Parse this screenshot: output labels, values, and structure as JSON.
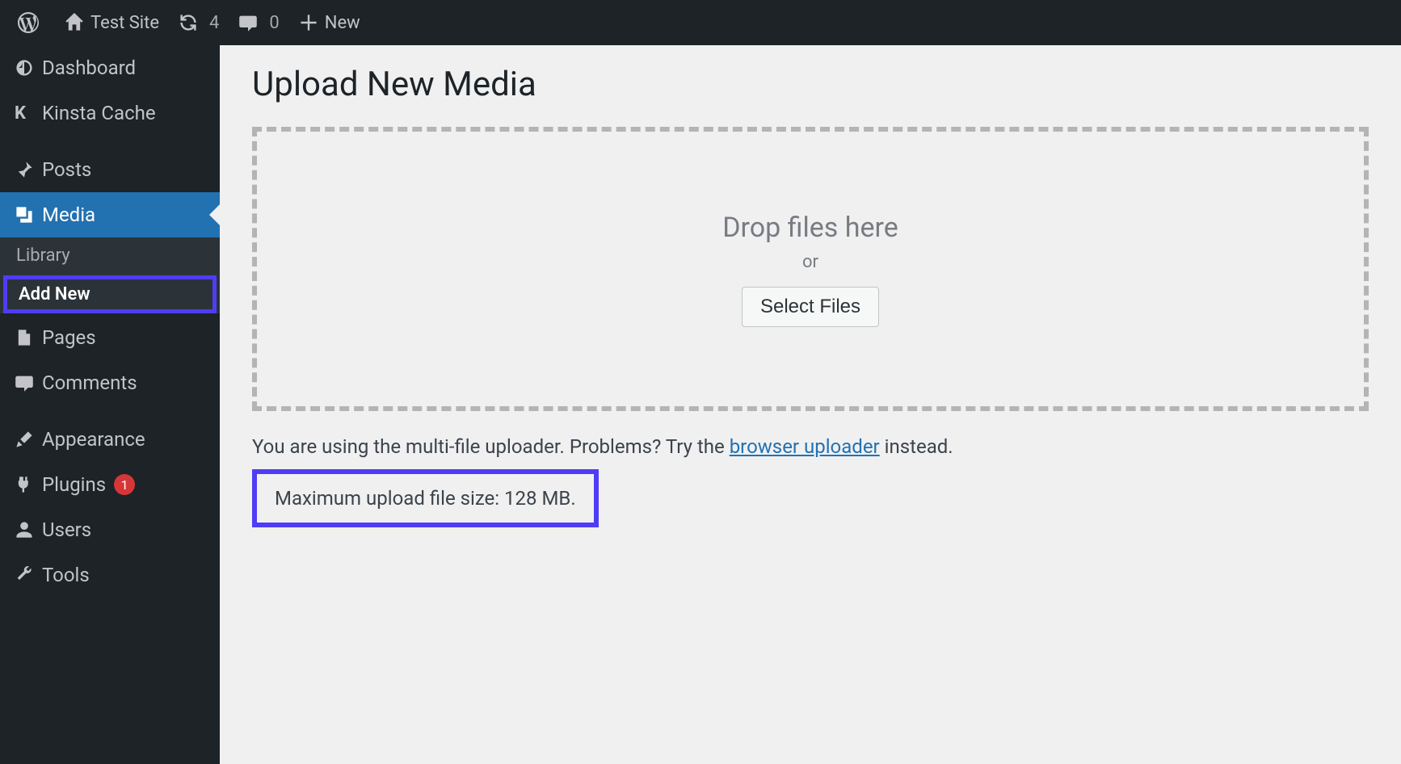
{
  "adminbar": {
    "site_name": "Test Site",
    "update_count": "4",
    "comment_count": "0",
    "new_label": "New"
  },
  "sidebar": {
    "items": [
      {
        "label": "Dashboard"
      },
      {
        "label": "Kinsta Cache"
      },
      {
        "label": "Posts"
      },
      {
        "label": "Media"
      },
      {
        "label": "Pages"
      },
      {
        "label": "Comments"
      },
      {
        "label": "Appearance"
      },
      {
        "label": "Plugins",
        "badge": "1"
      },
      {
        "label": "Users"
      },
      {
        "label": "Tools"
      }
    ],
    "submenu": {
      "library": "Library",
      "add_new": "Add New"
    }
  },
  "main": {
    "title": "Upload New Media",
    "drop_text": "Drop files here",
    "or": "or",
    "select_files": "Select Files",
    "uploader_note_pre": "You are using the multi-file uploader. Problems? Try the ",
    "uploader_link": "browser uploader",
    "uploader_note_post": " instead.",
    "max_size": "Maximum upload file size: 128 MB."
  }
}
